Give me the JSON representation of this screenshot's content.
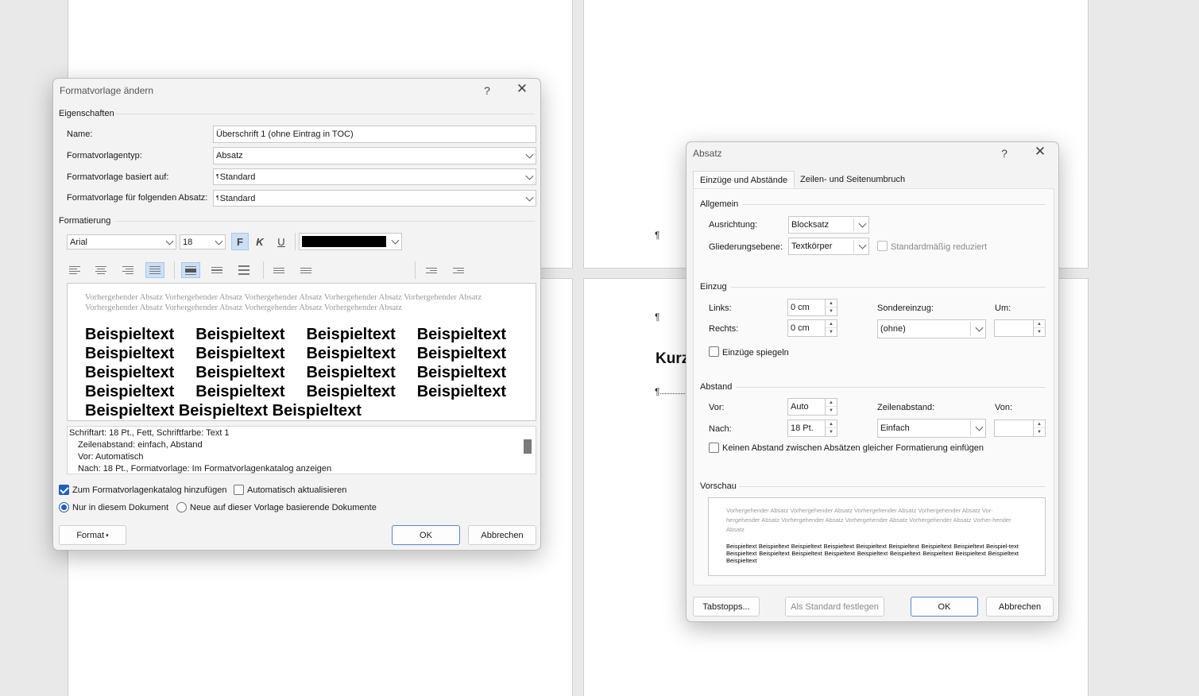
{
  "background_doc": {
    "paragraph_mark": "¶",
    "heading_fragment": "Kurz"
  },
  "style_dialog": {
    "title": "Formatvorlage ändern",
    "help_icon": "question-icon",
    "close_icon": "close-icon",
    "help_glyph": "?",
    "close_glyph": "✕",
    "properties_label": "Eigenschaften",
    "name_label": "Name:",
    "name_value": "Überschrift 1 (ohne Eintrag in TOC)",
    "type_label": "Formatvorlagentyp:",
    "type_value": "Absatz",
    "based_on_label": "Formatvorlage basiert auf:",
    "based_on_value": "Standard",
    "next_label": "Formatvorlage für folgenden Absatz:",
    "next_value": "Standard",
    "style_marker": "¶",
    "formatting_label": "Formatierung",
    "font_value": "Arial",
    "size_value": "18",
    "bold_label": "F",
    "italic_label": "K",
    "underline_label": "U",
    "font_color": "#000000",
    "preview_previous": "Vorhergehender Absatz Vorhergehender Absatz Vorhergehender Absatz Vorhergehender Absatz Vorhergehender Absatz Vorhergehender Absatz Vorhergehender Absatz Vorhergehender Absatz Vorhergehender Absatz",
    "preview_sample": "Beispieltext Beispieltext Beispieltext Beispieltext Beispieltext Beispieltext Beispieltext Beispieltext Beispieltext Beispieltext Beispieltext Beispieltext Beispieltext Beispieltext Beispieltext Beispieltext Beispieltext Beispieltext Beispieltext",
    "description_lines": [
      "Schriftart: 18 Pt., Fett, Schriftfarbe: Text 1",
      "Zeilenabstand:  einfach, Abstand",
      "Vor:  Automatisch",
      "Nach:  18 Pt., Formatvorlage: Im Formatvorlagenkatalog anzeigen"
    ],
    "add_to_gallery_label": "Zum Formatvorlagenkatalog hinzufügen",
    "add_to_gallery_checked": true,
    "auto_update_label": "Automatisch aktualisieren",
    "auto_update_checked": false,
    "only_this_doc_label": "Nur in diesem Dokument",
    "new_docs_label": "Neue auf dieser Vorlage basierende Dokumente",
    "format_button": "Format",
    "format_arrow": "▾",
    "ok_button": "OK",
    "cancel_button": "Abbrechen"
  },
  "paragraph_dialog": {
    "title": "Absatz",
    "help_glyph": "?",
    "close_glyph": "✕",
    "tabs": [
      "Einzüge und Abstände",
      "Zeilen- und Seitenumbruch"
    ],
    "general_label": "Allgemein",
    "alignment_label": "Ausrichtung:",
    "alignment_value": "Blocksatz",
    "outline_label": "Gliederungsebene:",
    "outline_value": "Textkörper",
    "collapsed_label": "Standardmäßig reduziert",
    "indent_label": "Einzug",
    "left_label": "Links:",
    "left_value": "0 cm",
    "right_label": "Rechts:",
    "right_value": "0 cm",
    "special_label": "Sondereinzug:",
    "special_value": "(ohne)",
    "by_label": "Um:",
    "by_value": "",
    "mirror_label": "Einzüge spiegeln",
    "spacing_label": "Abstand",
    "before_label": "Vor:",
    "before_value": "Auto",
    "after_label": "Nach:",
    "after_value": "18 Pt.",
    "line_spacing_label": "Zeilenabstand:",
    "line_spacing_value": "Einfach",
    "at_label": "Von:",
    "at_value": "",
    "no_space_label": "Keinen Abstand zwischen Absätzen gleicher Formatierung einfügen",
    "preview_label": "Vorschau",
    "preview_previous": "Vorhergehender Absatz Vorhergehender Absatz Vorhergehender Absatz Vorhergehender Absatz Vor-hergehender Absatz Vorhergehender Absatz Vorhergehender Absatz Vorhergehender Absatz Vorher-hender Absatz",
    "preview_sample": "Beispieltext Beispieltext Beispieltext Beispieltext Beispieltext Beispieltext Beispieltext Beispieltext Beispiel-text Beispieltext Beispieltext Beispieltext Beispieltext Beispieltext Beispieltext Beispieltext Beispieltext Beispieltext Beispieltext",
    "tabs_button": "Tabstopps...",
    "default_button": "Als Standard festlegen",
    "ok_button": "OK",
    "cancel_button": "Abbrechen"
  }
}
